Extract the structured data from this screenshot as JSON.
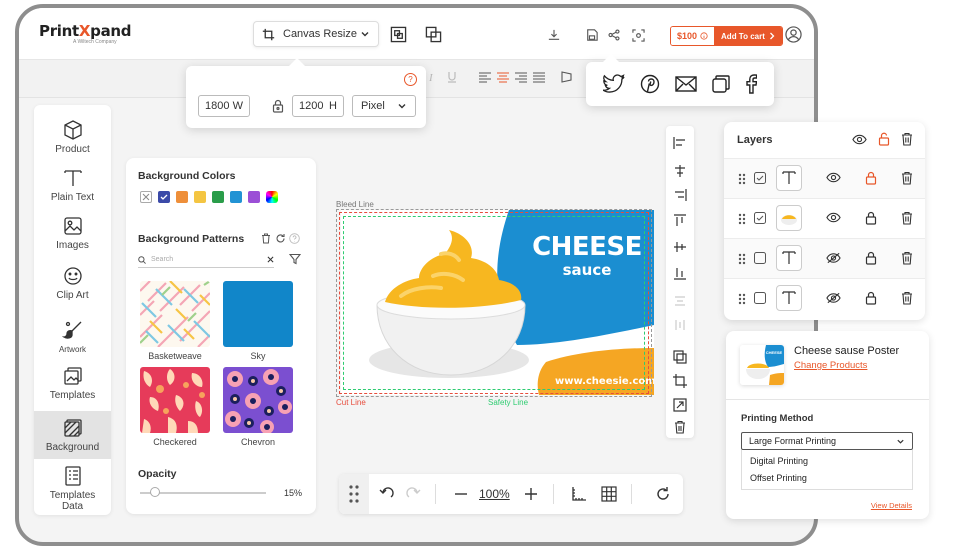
{
  "brand": {
    "name_part1": "Print",
    "name_part2": "X",
    "name_part3": "pand",
    "tagline": "A Wiltech Company"
  },
  "topbar": {
    "canvas_resize_label": "Canvas Resize",
    "price": "$100",
    "add_to_cart": "Add To cart"
  },
  "resize_popover": {
    "help": "?",
    "width_value": "1800",
    "width_unit": "W",
    "height_value": "1200",
    "height_unit": "H",
    "unit_select": "Pixel"
  },
  "share_icons": [
    "twitter-icon",
    "pinterest-icon",
    "mail-icon",
    "copy-icon",
    "facebook-icon"
  ],
  "sidebar": {
    "items": [
      {
        "label": "Product",
        "icon": "cube-icon"
      },
      {
        "label": "Plain Text",
        "icon": "text-icon"
      },
      {
        "label": "Images",
        "icon": "image-icon"
      },
      {
        "label": "Clip Art",
        "icon": "smiley-icon"
      },
      {
        "label": "Artwork",
        "icon": "brush-icon"
      },
      {
        "label": "Templates",
        "icon": "templates-icon"
      },
      {
        "label": "Background",
        "icon": "background-icon"
      },
      {
        "label": "Templates Data",
        "icon": "templates-data-icon"
      }
    ],
    "active": "Background"
  },
  "background_panel": {
    "colors_title": "Background Colors",
    "colors": [
      "#ffffff",
      "#3b4aa8",
      "#ee8f3a",
      "#f4c542",
      "#2a9d4a",
      "#2293d4",
      "#9b4fd6"
    ],
    "patterns_title": "Background Patterns",
    "search_placeholder": "Search",
    "patterns": [
      {
        "label": "Basketweave"
      },
      {
        "label": "Sky"
      },
      {
        "label": "Checkered"
      },
      {
        "label": "Chevron"
      }
    ],
    "opacity_title": "Opacity",
    "opacity_value": "15%",
    "opacity_fraction": 0.15
  },
  "stage": {
    "bleed_line": "Bleed Line",
    "cut_line": "Cut Line",
    "safety_line": "Safety Line",
    "poster_title": "CHEESE",
    "poster_subtitle": "sauce",
    "poster_url": "www.cheesie.com",
    "colors": {
      "blue": "#1b8ed1",
      "orange": "#f5a623",
      "bleed": "#999999",
      "cut": "#e74c3c",
      "safety": "#2ecc71"
    }
  },
  "zoombar": {
    "zoom": "100%"
  },
  "layers": {
    "title": "Layers",
    "rows": [
      {
        "thumb": "text",
        "checked": true,
        "visible": true,
        "locked": true
      },
      {
        "thumb": "image",
        "checked": true,
        "visible": true,
        "locked": true
      },
      {
        "thumb": "text",
        "checked": false,
        "visible": false,
        "locked": true
      },
      {
        "thumb": "text",
        "checked": false,
        "visible": false,
        "locked": true
      }
    ]
  },
  "product": {
    "name": "Cheese sause Poster",
    "change_link": "Change Products",
    "thumb_title": "CHEESE",
    "printing_method_title": "Printing Method",
    "selected_method": "Large Format Printing",
    "options": [
      "Digital Printing",
      "Offset Printing"
    ],
    "view_details": "View Details"
  },
  "accent_color": "#e8572a"
}
